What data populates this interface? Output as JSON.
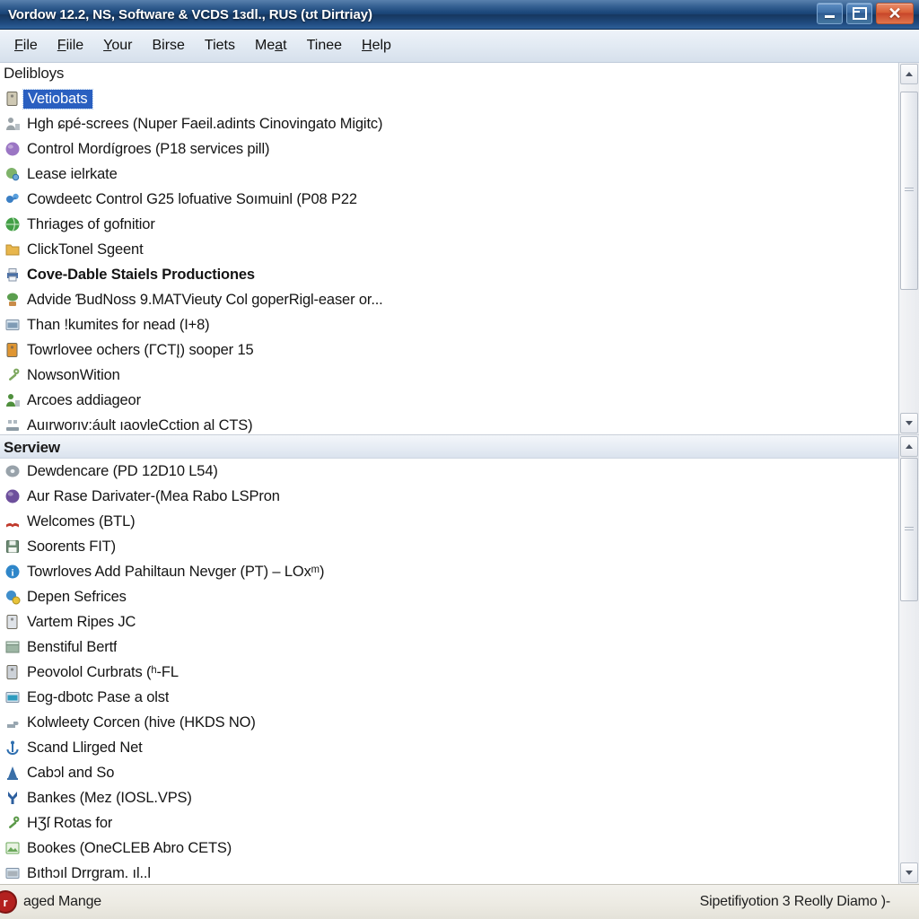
{
  "window": {
    "title": "Vordow 12.2, NS, Software & VCDS 1ɜdl., RUS (ʊt Dirtriay)",
    "controls": {
      "minimize_label": "_",
      "restore_label": "restore",
      "close_label": "✕"
    }
  },
  "menubar": {
    "items": [
      {
        "label": "File",
        "mnemonic": "F"
      },
      {
        "label": "Fiile",
        "mnemonic": "F"
      },
      {
        "label": "Your",
        "mnemonic": "Y"
      },
      {
        "label": "Birse",
        "mnemonic": ""
      },
      {
        "label": "Tiets",
        "mnemonic": ""
      },
      {
        "label": "Meat",
        "mnemonic": "a"
      },
      {
        "label": "Tinee",
        "mnemonic": ""
      },
      {
        "label": "Help",
        "mnemonic": "H"
      }
    ]
  },
  "top_pane": {
    "header": "Delibloys",
    "items": [
      {
        "label": "Vetiobats",
        "icon": "document-lock-icon",
        "color": "#cfc9b4",
        "selected": true,
        "bold": false
      },
      {
        "label": "Hgh ɕpé-screes (Nuper Faeil.adints Cinovingato Migitc)",
        "icon": "user-gray-icon",
        "color": "#9aa3a8",
        "selected": false,
        "bold": false
      },
      {
        "label": "Control Mordígroes (P18 services pill)",
        "icon": "purple-sphere-icon",
        "color": "#9b76c4",
        "selected": false,
        "bold": false
      },
      {
        "label": "Lease ielrkate",
        "icon": "globe-search-icon",
        "color": "#7fb36a",
        "selected": false,
        "bold": false
      },
      {
        "label": "Cowdeetc Control G25 lofuative Soımuinl (P08 P22",
        "icon": "blue-link-icon",
        "color": "#3b7fc4",
        "selected": false,
        "bold": false
      },
      {
        "label": "Thriages of gofnitior",
        "icon": "green-globe-icon",
        "color": "#43a047",
        "selected": false,
        "bold": false
      },
      {
        "label": "ClickTonel Sgeent",
        "icon": "folder-yellow-icon",
        "color": "#e8b64c",
        "selected": false,
        "bold": false
      },
      {
        "label": "Cove-Dable Staiels Productiones",
        "icon": "printer-icon",
        "color": "#4a6fa5",
        "selected": false,
        "bold": true
      },
      {
        "label": "Advide ƁudNoss 9.MATVieuty Col goperRigl-easer or...",
        "icon": "plant-green-icon",
        "color": "#5b9e4e",
        "selected": false,
        "bold": false
      },
      {
        "label": "Than !kumites for nead (I+8)",
        "icon": "console-window-icon",
        "color": "#7f9bb5",
        "selected": false,
        "bold": false
      },
      {
        "label": "Towrlovee ochers (ГCTĮ) sooper 15",
        "icon": "orange-note-icon",
        "color": "#df9532",
        "selected": false,
        "bold": false
      },
      {
        "label": "NowsonWition",
        "icon": "wrench-tool-icon",
        "color": "#7ea85f",
        "selected": false,
        "bold": false
      },
      {
        "label": "Arcoes addiageor",
        "icon": "person-green-icon",
        "color": "#4f8f3d",
        "selected": false,
        "bold": false
      },
      {
        "label": "Auırworıv:áult ıaovleCction al CTS)",
        "icon": "network-gray-icon",
        "color": "#8c9aa4",
        "selected": false,
        "bold": false
      }
    ],
    "scrollbar": {
      "thumb_top_pct": 2,
      "thumb_height_pct": 60
    }
  },
  "bottom_pane": {
    "header": "Serview",
    "items": [
      {
        "label": "Dewdencare (PD 12D10 L54)",
        "icon": "gray-disc-icon",
        "color": "#98a2aa",
        "selected": false,
        "bold": false
      },
      {
        "label": "Aur Rase Darivater-(Mea Rabo LSPron",
        "icon": "purple-shield-icon",
        "color": "#6d4f9c",
        "selected": false,
        "bold": false
      },
      {
        "label": "Welcomes (BTL)",
        "icon": "red-book-icon",
        "color": "#c0392b",
        "selected": false,
        "bold": false
      },
      {
        "label": "Soorents FIT)",
        "icon": "save-disk-icon",
        "color": "#6e8b74",
        "selected": false,
        "bold": false
      },
      {
        "label": "Towrloves Add Pahiltaun Nevger (PT) – LOxᵐ)",
        "icon": "blue-info-icon",
        "color": "#2f86c9",
        "selected": false,
        "bold": false
      },
      {
        "label": "Depen Sefrices",
        "icon": "services-gear-icon",
        "color": "#3f8ecb",
        "selected": false,
        "bold": false
      },
      {
        "label": "Vartem Ripes JC",
        "icon": "white-page-icon",
        "color": "#dfe3e8",
        "selected": false,
        "bold": false
      },
      {
        "label": "Benstiful Bertf",
        "icon": "archive-box-icon",
        "color": "#9db6a4",
        "selected": false,
        "bold": false
      },
      {
        "label": "Peovolol Curbrats (ʰ-FL",
        "icon": "gray-card-icon",
        "color": "#cdd2d8",
        "selected": false,
        "bold": false
      },
      {
        "label": "Eog-dbotc Pase a olst",
        "icon": "cyan-terminal-icon",
        "color": "#2e9bbf",
        "selected": false,
        "bold": false
      },
      {
        "label": "Kolwleety Corcen (hive (HKDS NO)",
        "icon": "gray-faucet-icon",
        "color": "#98a6b0",
        "selected": false,
        "bold": false
      },
      {
        "label": "Scand Llirged Net",
        "icon": "blue-anchor-icon",
        "color": "#2f6fb0",
        "selected": false,
        "bold": false
      },
      {
        "label": "Cabɔl and So",
        "icon": "blue-tower-icon",
        "color": "#3a6fa8",
        "selected": false,
        "bold": false
      },
      {
        "label": "Bankes (Mez (IOSL.VPS)",
        "icon": "blue-shape-icon",
        "color": "#2d5f9e",
        "selected": false,
        "bold": false
      },
      {
        "label": "HƷſ Rotas for",
        "icon": "green-key-icon",
        "color": "#5c9a4a",
        "selected": false,
        "bold": false
      },
      {
        "label": "Bookes (OneCLEB Abro CETS)",
        "icon": "green-image-icon",
        "color": "#6aa85a",
        "selected": false,
        "bold": false
      },
      {
        "label": "Bıthɔıl Drrgram. ıl..l",
        "icon": "gray-window-icon",
        "color": "#a9b2ba",
        "selected": false,
        "bold": false
      }
    ],
    "scrollbar": {
      "thumb_top_pct": 0,
      "thumb_height_pct": 35
    }
  },
  "statusbar": {
    "icon": "red-circle-icon",
    "left_text": "aged Mange",
    "right_text": "Sipetifiyotion 3 Reolly Diamo )-"
  },
  "colors": {
    "title_gradient_start": "#2a5d96",
    "title_gradient_end": "#16375f",
    "selection_blue": "#2a5fc0",
    "close_red": "#d95f36",
    "menubar_bg": "#e2eaf3",
    "status_bg": "#eceae2"
  }
}
